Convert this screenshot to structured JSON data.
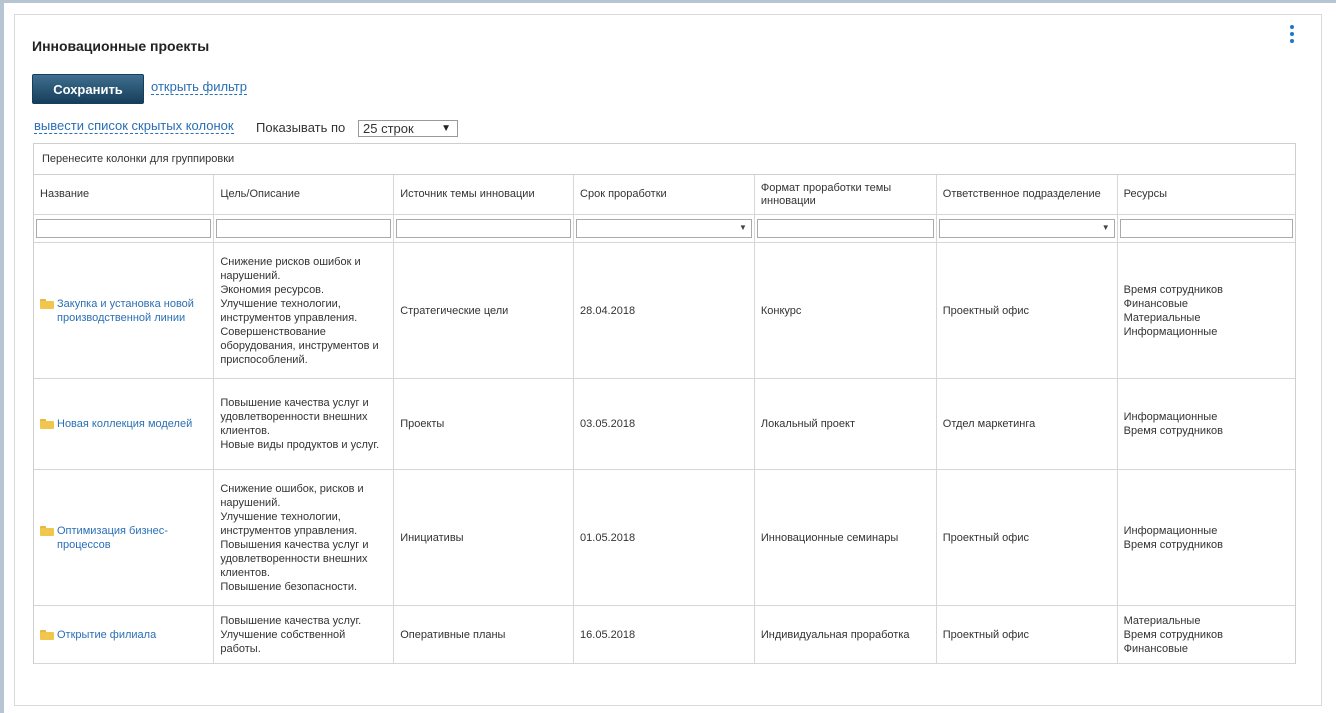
{
  "page": {
    "title": "Инновационные проекты",
    "save_label": "Сохранить",
    "filter_link": "открыть фильтр",
    "hidden_columns_link": "вывести список скрытых колонок",
    "show_label": "Показывать по",
    "rows_select": "25 строк",
    "group_hint": "Перенесите колонки для группировки"
  },
  "columns": [
    "Название",
    "Цель/Описание",
    "Источник темы инновации",
    "Срок проработки",
    "Формат проработки темы инновации",
    "Ответственное подразделение",
    "Ресурсы"
  ],
  "rows": [
    {
      "name": "Закупка и установка новой производственной линии",
      "desc": "Снижение рисков ошибок и нарушений.\nЭкономия ресурсов.\nУлучшение технологии, инструментов управления.\nСовершенствование оборудования, инструментов и приспособлений.",
      "source": "Стратегические цели",
      "date": "28.04.2018",
      "format": "Конкурс",
      "dept": "Проектный офис",
      "resources": "Время сотрудников\nФинансовые\nМатериальные\nИнформационные"
    },
    {
      "name": "Новая коллекция моделей",
      "desc": "Повышение качества услуг и удовлетворенности внешних клиентов.\nНовые виды продуктов и услуг.",
      "source": "Проекты",
      "date": "03.05.2018",
      "format": "Локальный проект",
      "dept": "Отдел маркетинга",
      "resources": "Информационные\nВремя сотрудников"
    },
    {
      "name": "Оптимизация бизнес-процессов",
      "desc": "Снижение ошибок, рисков и нарушений.\nУлучшение технологии, инструментов управления.\nПовышения качества услуг и удовлетворенности внешних клиентов.\nПовышение безопасности.",
      "source": "Инициативы",
      "date": "01.05.2018",
      "format": "Инновационные семинары",
      "dept": "Проектный офис",
      "resources": "Информационные\nВремя сотрудников"
    },
    {
      "name": "Открытие филиала",
      "desc": "Повышение качества услуг.\nУлучшение собственной работы.",
      "source": "Оперативные планы",
      "date": "16.05.2018",
      "format": "Индивидуальная проработка",
      "dept": "Проектный офис",
      "resources": "Материальные\nВремя сотрудников\nФинансовые"
    }
  ]
}
